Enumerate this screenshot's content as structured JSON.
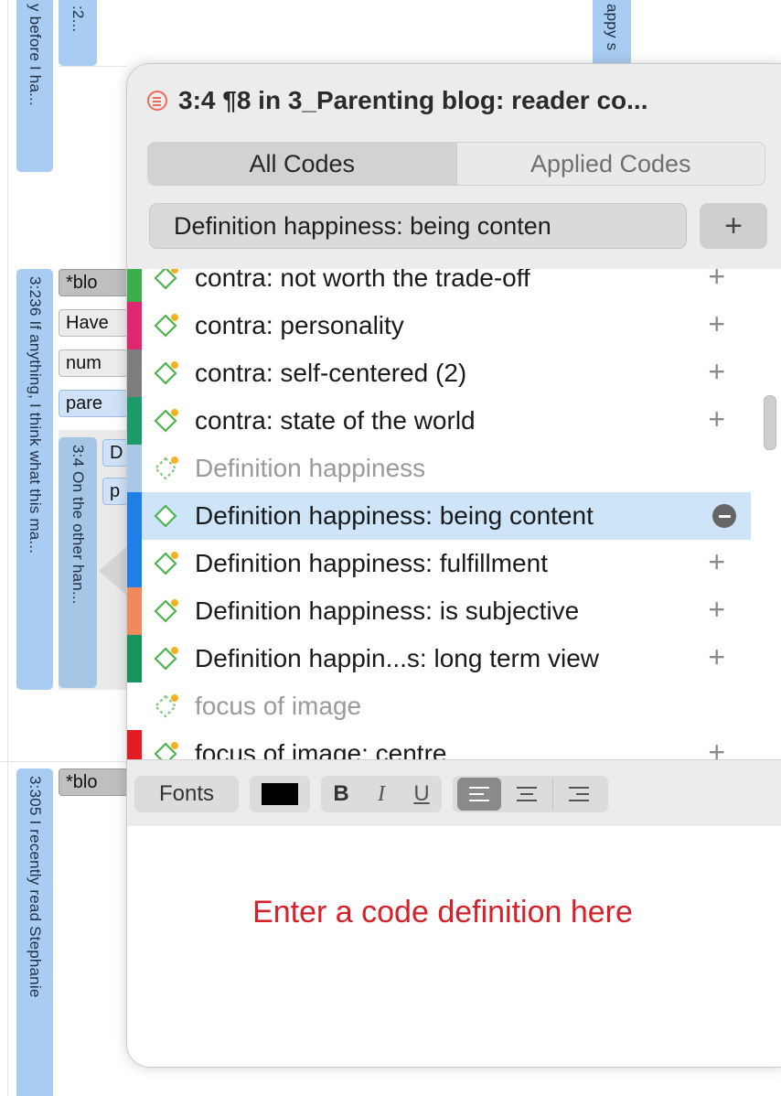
{
  "background": {
    "col1_top_text": "y before I ha...",
    "col2_top_text": ":2...",
    "right_top_text": "appy s",
    "col1_mid_text": "3:236 If anything, I think what this ma...",
    "col3_mid_text": "3:4 On the other han...",
    "col1_bottom_text": "3:305 I recently read Stephanie",
    "tags_mid": [
      "*blo",
      "Have",
      "num",
      "pare"
    ],
    "tags_mini": [
      "D",
      "p"
    ],
    "tag_bottom": "*blo"
  },
  "popover": {
    "title": "3:4 ¶8 in 3_Parenting blog: reader co...",
    "tabs": [
      "All Codes",
      "Applied Codes"
    ],
    "active_tab": "All Codes",
    "code_field_value": "Definition happiness: being conten",
    "add_button": "+",
    "codes": [
      {
        "label": "contra: not worth the trade-off",
        "action": "+",
        "dimmed": false,
        "selected": false,
        "group": false
      },
      {
        "label": "contra: personality",
        "action": "+",
        "dimmed": false,
        "selected": false,
        "group": false
      },
      {
        "label": "contra: self-centered (2)",
        "action": "+",
        "dimmed": false,
        "selected": false,
        "group": false
      },
      {
        "label": "contra: state of the world",
        "action": "+",
        "dimmed": false,
        "selected": false,
        "group": false
      },
      {
        "label": "Definition happiness",
        "action": "",
        "dimmed": true,
        "selected": false,
        "group": true
      },
      {
        "label": "Definition happiness: being content",
        "action": "remove",
        "dimmed": false,
        "selected": true,
        "group": false
      },
      {
        "label": "Definition happiness: fulfillment",
        "action": "+",
        "dimmed": false,
        "selected": false,
        "group": false
      },
      {
        "label": "Definition happiness: is subjective",
        "action": "+",
        "dimmed": false,
        "selected": false,
        "group": false
      },
      {
        "label": "Definition happin...s: long term view",
        "action": "+",
        "dimmed": false,
        "selected": false,
        "group": false
      },
      {
        "label": "focus of image",
        "action": "",
        "dimmed": true,
        "selected": false,
        "group": true
      },
      {
        "label": "focus of image: centre",
        "action": "+",
        "dimmed": false,
        "selected": false,
        "group": false
      }
    ],
    "code_colors": [
      "#3bb04a",
      "#e0266f",
      "#7d7d7d",
      "#1b9a6c",
      "#a9c7e8",
      "#1f7fe8",
      "#1f7fe8",
      "#f08a5d",
      "#16935f",
      "#ffffff",
      "#e31b23"
    ],
    "toolbar": {
      "fonts": "Fonts",
      "bold": "B",
      "italic": "I",
      "underline": "U",
      "text_color": "#000000"
    },
    "placeholder": "Enter a code definition here"
  }
}
